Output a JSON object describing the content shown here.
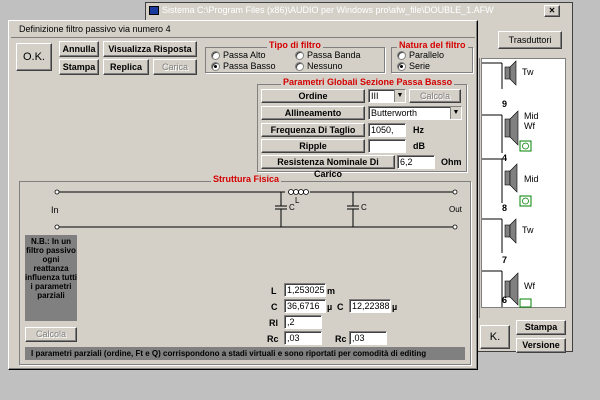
{
  "bg_window": {
    "title": "Sistema C:\\Program Files (x86)\\AUDIO per Windows pro\\afw_file\\DOUBLE_1.AFW",
    "close_label": "✕",
    "trasduttori_label": "Trasduttori",
    "stampa_label": "Stampa",
    "versione_label": "Versione",
    "ok_label": "K.",
    "speakers": [
      {
        "label": "Tw",
        "num": "9"
      },
      {
        "label": "Mid\nWf",
        "num": "4"
      },
      {
        "label": "Mid",
        "num": "8"
      },
      {
        "label": "Tw",
        "num": "7"
      },
      {
        "label": "Wf",
        "num": "6"
      }
    ]
  },
  "dialog": {
    "title": "Definizione filtro passivo via numero 4",
    "ok_label": "O.K.",
    "annulla_label": "Annulla",
    "visualizza_label": "Visualizza Risposta",
    "stampa_label": "Stampa",
    "replica_label": "Replica",
    "carica_label": "Carica",
    "tipo": {
      "title": "Tipo di filtro",
      "options": [
        "Passa Alto",
        "Passa Banda",
        "Passa Basso",
        "Nessuno"
      ],
      "selected": "Passa Basso"
    },
    "natura": {
      "title": "Natura del filtro",
      "options": [
        "Parallelo",
        "Serie"
      ],
      "selected": "Serie"
    },
    "parametri": {
      "title": "Parametri Globali Sezione Passa Basso",
      "ordine_label": "Ordine",
      "ordine_value": "III",
      "calcola_label": "Calcola",
      "allineamento_label": "Allineamento",
      "allineamento_value": "Butterworth",
      "freq_label": "Frequenza Di Taglio",
      "freq_value": "1050,",
      "freq_unit": "Hz",
      "ripple_label": "Ripple",
      "ripple_value": "",
      "ripple_unit": "dB",
      "res_label": "Resistenza Nominale Di Carico",
      "res_value": "6,2",
      "res_unit": "Ohm"
    },
    "struttura": {
      "title": "Struttura Fisica",
      "in_label": "In",
      "out_label": "Out",
      "l_label": "L",
      "c1_label": "C",
      "c2_label": "C",
      "note": "N.B.: In un filtro passivo ogni reattanza influenza tutti i parametri parziali",
      "calcola_label": "Calcola",
      "L_label": "L",
      "L_value": "1,253025",
      "L_unit": "m",
      "C1_label": "C",
      "C1_value": "36,6716",
      "C1_unit": "µ",
      "C2_label": "C",
      "C2_value": "12,22388",
      "C2_unit": "µ",
      "Rl_label": "Rl",
      "Rl_value": ",2",
      "Rc1_label": "Rc",
      "Rc1_value": ",03",
      "Rc2_label": "Rc",
      "Rc2_value": ",03",
      "footer": "I parametri parziali (ordine, Ft e Q) corrispondono a stadi virtuali e sono riportati per comodità di editing"
    }
  }
}
